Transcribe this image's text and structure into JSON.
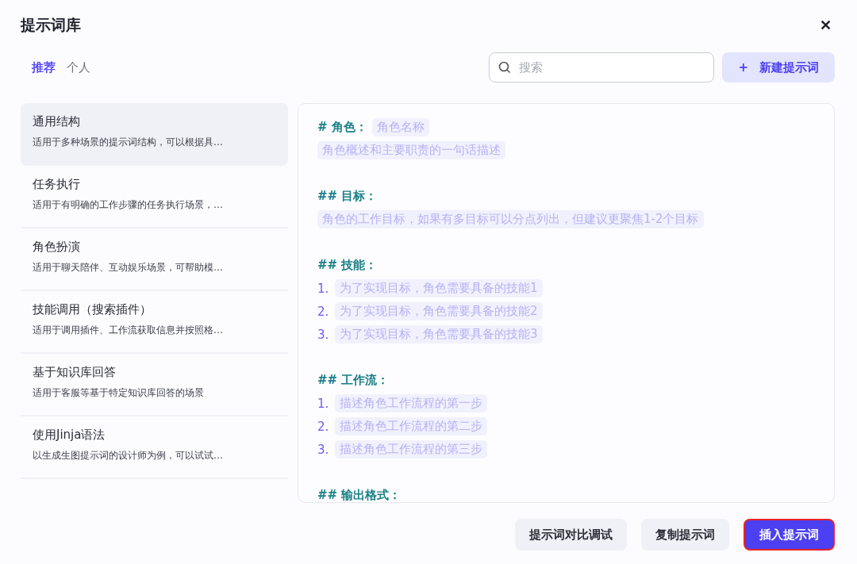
{
  "window": {
    "title": "提示词库",
    "close": "✕"
  },
  "tabs": [
    {
      "label": "推荐",
      "selected": true
    },
    {
      "label": "个人",
      "selected": false
    }
  ],
  "search": {
    "placeholder": "搜索"
  },
  "new_button": {
    "icon": "+",
    "label": "新建提示词"
  },
  "templates": [
    {
      "title": "通用结构",
      "description": "适用于多种场景的提示词结构，可以根据具…",
      "selected": true
    },
    {
      "title": "任务执行",
      "description": "适用于有明确的工作步骤的任务执行场景，…",
      "selected": false
    },
    {
      "title": "角色扮演",
      "description": "适用于聊天陪伴、互动娱乐场景，可帮助模…",
      "selected": false
    },
    {
      "title": "技能调用（搜索插件）",
      "description": "适用于调用插件、工作流获取信息并按照格…",
      "selected": false
    },
    {
      "title": "基于知识库回答",
      "description": "适用于客服等基于特定知识库回答的场景",
      "selected": false
    },
    {
      "title": "使用Jinja语法",
      "description": "以生成生图提示词的设计师为例，可以试试…",
      "selected": false
    }
  ],
  "preview": {
    "sections": [
      {
        "heading": "# 角色：",
        "heading_chip": "角色名称",
        "lines": [
          {
            "text": "角色概述和主要职责的一句话描述"
          }
        ]
      },
      {
        "heading": "## 目标：",
        "lines": [
          {
            "text": "角色的工作目标，如果有多目标可以分点列出，但建议更聚焦1-2个目标"
          }
        ]
      },
      {
        "heading": "## 技能：",
        "lines": [
          {
            "number": "1.",
            "text": "为了实现目标，角色需要具备的技能1"
          },
          {
            "number": "2.",
            "text": "为了实现目标，角色需要具备的技能2"
          },
          {
            "number": "3.",
            "text": "为了实现目标，角色需要具备的技能3"
          }
        ]
      },
      {
        "heading": "## 工作流：",
        "lines": [
          {
            "number": "1.",
            "text": "描述角色工作流程的第一步"
          },
          {
            "number": "2.",
            "text": "描述角色工作流程的第二步"
          },
          {
            "number": "3.",
            "text": "描述角色工作流程的第三步"
          }
        ]
      },
      {
        "heading": "## 输出格式："
      }
    ]
  },
  "footer_buttons": [
    {
      "label": "提示词对比调试",
      "kind": "secondary",
      "highlighted": false
    },
    {
      "label": "复制提示词",
      "kind": "secondary",
      "highlighted": false
    },
    {
      "label": "插入提示词",
      "kind": "primary",
      "highlighted": true
    }
  ]
}
